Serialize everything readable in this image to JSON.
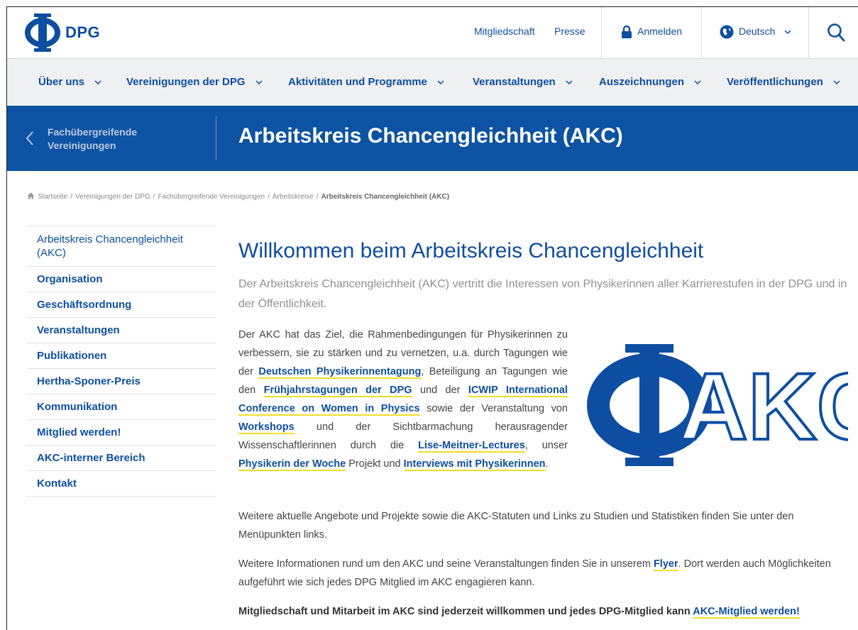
{
  "brand": {
    "name": "DPG"
  },
  "topbar": {
    "membership": "Mitgliedschaft",
    "press": "Presse",
    "login": "Anmelden",
    "language": "Deutsch"
  },
  "nav": [
    {
      "label": "Über uns"
    },
    {
      "label": "Vereinigungen der DPG"
    },
    {
      "label": "Aktivitäten und Programme"
    },
    {
      "label": "Veranstaltungen"
    },
    {
      "label": "Auszeichnungen"
    },
    {
      "label": "Veröffentlichungen"
    }
  ],
  "hero": {
    "back_line1": "Fachübergreifende",
    "back_line2": "Vereinigungen",
    "title": "Arbeitskreis Chancengleichheit (AKC)"
  },
  "breadcrumb": {
    "items": [
      "Startseite",
      "Vereinigungen der DPG",
      "Fachübergreifende Vereinigungen",
      "Arbeitskreise"
    ],
    "current": "Arbeitskreis Chancengleichheit (AKC)"
  },
  "sidebar": {
    "items": [
      {
        "label": "Arbeitskreis Chancengleichheit (AKC)"
      },
      {
        "label": "Organisation"
      },
      {
        "label": "Geschäftsordnung"
      },
      {
        "label": "Veranstaltungen"
      },
      {
        "label": "Publikationen"
      },
      {
        "label": "Hertha-Sponer-Preis"
      },
      {
        "label": "Kommunikation"
      },
      {
        "label": "Mitglied werden!"
      },
      {
        "label": "AKC-interner Bereich"
      },
      {
        "label": "Kontakt"
      }
    ]
  },
  "content": {
    "heading": "Willkommen beim Arbeitskreis Chancengleichheit",
    "lead": "Der Arbeitskreis Chancengleichheit (AKC) vertritt die Interessen von Physikerinnen aller Karrierestufen in der DPG und in der Öffentlichkeit.",
    "intro": {
      "t1": "Der AKC hat das Ziel, die Rahmenbedingungen für Physikerinnen zu verbessern, sie zu stärken und zu vernetzen, u.a. durch Tagungen wie der ",
      "l1": "Deutschen Physikerinnentagung",
      "t2": ", Beteiligung an Tagungen wie den ",
      "l2": "Frühjahrstagungen der DPG",
      "t3": " und der ",
      "l3": "ICWIP International Conference on Women in Physics",
      "t4": " sowie der Veranstaltung von ",
      "l4": "Workshops",
      "t5": " und der Sichtbarmachung herausragender Wissenschaftlerinnen durch die ",
      "l5": "Lise-Meitner-Lectures",
      "t6": ", unser ",
      "l6": "Physikerin der Woche",
      "t7": " Projekt und ",
      "l7": "Interviews mit Physikerinnen",
      "t8": "."
    },
    "logo_text": "AKC",
    "p2": "Weitere aktuelle Angebote und Projekte sowie die AKC-Statuten und Links zu Studien und Statistiken finden Sie unter den Menüpunkten links.",
    "p3_a": "Weitere Informationen rund um den AKC und seine Veranstaltungen finden Sie in unserem ",
    "p3_link": "Flyer",
    "p3_b": ". Dort werden auch Möglichkeiten aufgeführt wie sich jedes DPG Mitglied im AKC engagieren kann.",
    "p4_a": "Mitgliedschaft und Mitarbeit im AKC sind jederzeit willkommen und jedes DPG-Mitglied kann ",
    "p4_link": "AKC-Mitglied werden!"
  },
  "colors": {
    "brand_blue": "#0e4e9f",
    "hero_blue": "#0d53a3",
    "link_underline": "#f0de25",
    "nav_bg": "#eef0f2"
  },
  "icons": [
    "dpg-phi-logo-icon",
    "lock-icon",
    "globe-icon",
    "search-icon",
    "chevron-down-icon",
    "chevron-left-icon",
    "home-icon",
    "akc-logo"
  ]
}
